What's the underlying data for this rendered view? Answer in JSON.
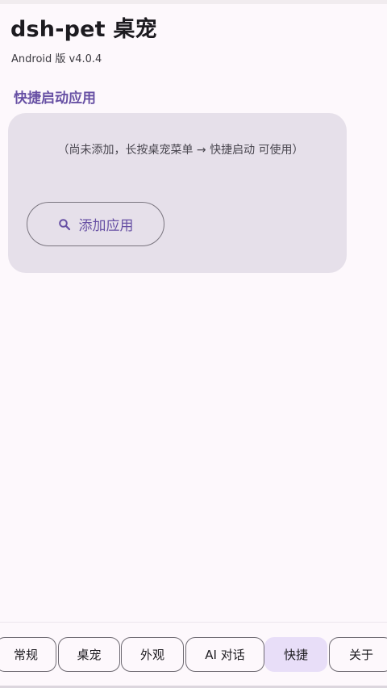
{
  "app": {
    "title": "dsh-pet 桌宠",
    "version": "Android 版 v4.0.4"
  },
  "shortcuts": {
    "section_title": "快捷启动应用",
    "empty_hint": "（尚未添加，长按桌宠菜单 → 快捷启动 可使用）",
    "add_button_label": "添加应用",
    "add_button_icon": "search-icon"
  },
  "tabs": [
    {
      "label": "常规",
      "active": false
    },
    {
      "label": "桌宠",
      "active": false
    },
    {
      "label": "外观",
      "active": false
    },
    {
      "label": "AI 对话",
      "active": false
    },
    {
      "label": "快捷",
      "active": true
    },
    {
      "label": "关于",
      "active": false
    }
  ],
  "colors": {
    "accent": "#6750a4",
    "card_background": "#e6e0ea",
    "active_tab": "#e8def8",
    "page_background": "#fdf8fc"
  }
}
